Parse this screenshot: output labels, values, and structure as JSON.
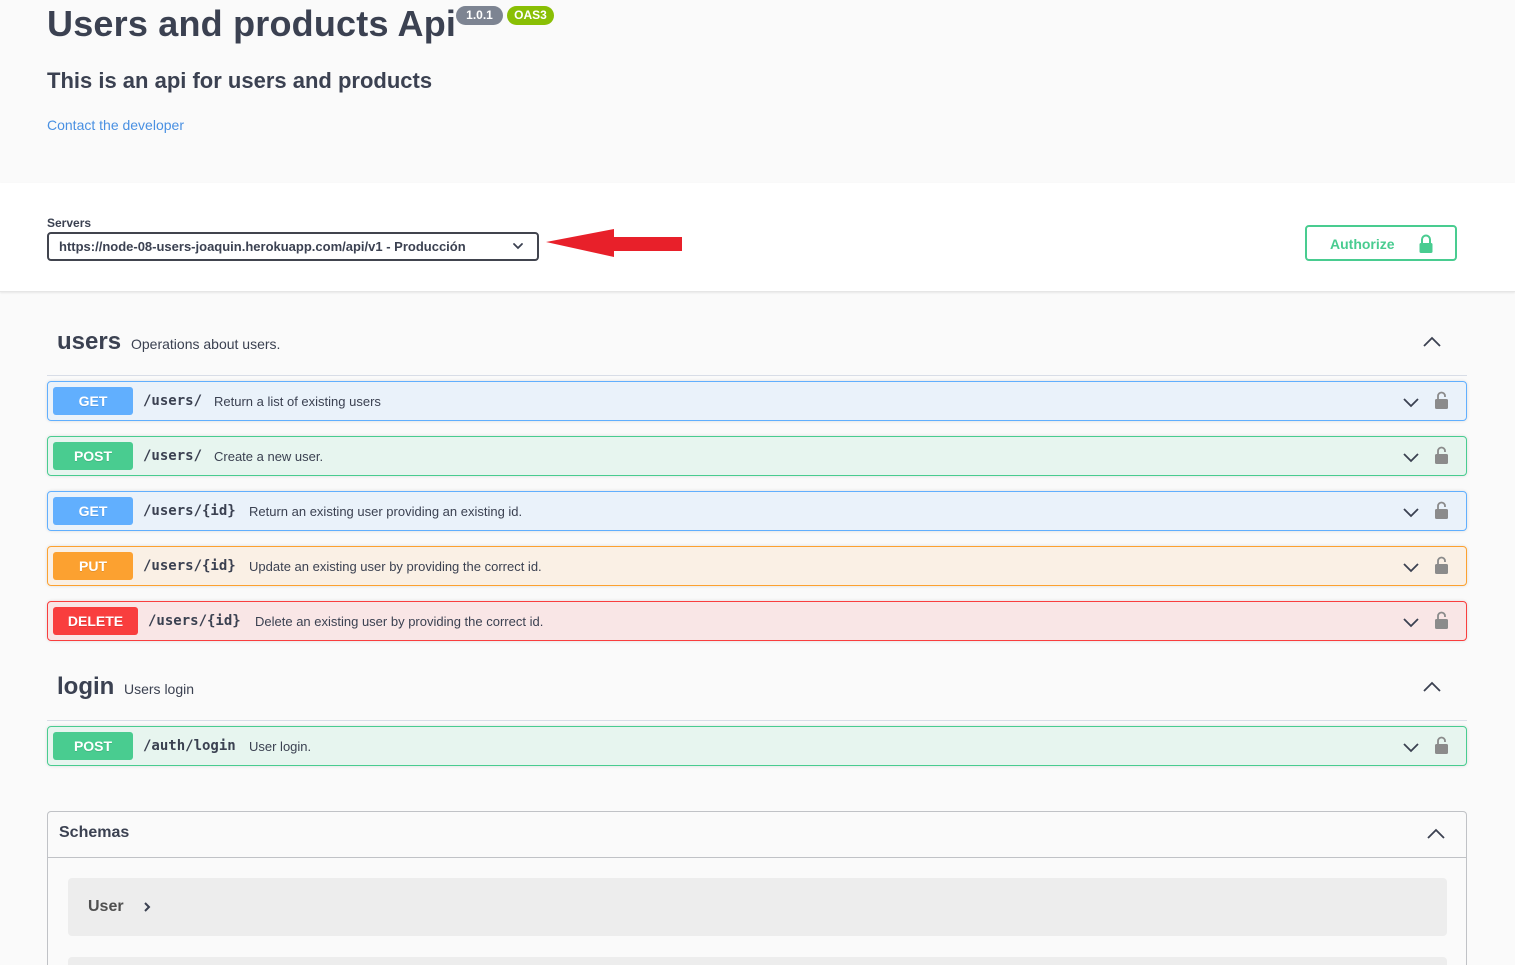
{
  "info": {
    "title": "Users and products Api",
    "version": "1.0.1",
    "oas": "OAS3",
    "description": "This is an api for users and products",
    "contact_link": "Contact the developer"
  },
  "servers": {
    "label": "Servers",
    "selected": "https://node-08-users-joaquin.herokuapp.com/api/v1 - Producción",
    "annotation": "red-arrow-pointing-to-server-select"
  },
  "authorize": {
    "label": "Authorize",
    "icon": "lock-icon"
  },
  "tags": [
    {
      "name": "users",
      "description": "Operations about users.",
      "operations": [
        {
          "method": "GET",
          "path": "/users/",
          "summary": "Return a list of existing users"
        },
        {
          "method": "POST",
          "path": "/users/",
          "summary": "Create a new user."
        },
        {
          "method": "GET",
          "path": "/users/{id}",
          "summary": "Return an existing user providing an existing id."
        },
        {
          "method": "PUT",
          "path": "/users/{id}",
          "summary": "Update an existing user by providing the correct id."
        },
        {
          "method": "DELETE",
          "path": "/users/{id}",
          "summary": "Delete an existing user by providing the correct id."
        }
      ]
    },
    {
      "name": "login",
      "description": "Users login",
      "operations": [
        {
          "method": "POST",
          "path": "/auth/login",
          "summary": "User login."
        }
      ]
    }
  ],
  "schemas": {
    "title": "Schemas",
    "models": [
      "User"
    ]
  },
  "colors": {
    "get": "#61affe",
    "post": "#49cc90",
    "put": "#fca130",
    "delete": "#f93e3e",
    "link": "#4990e2",
    "annotation_arrow": "#e8202a"
  }
}
